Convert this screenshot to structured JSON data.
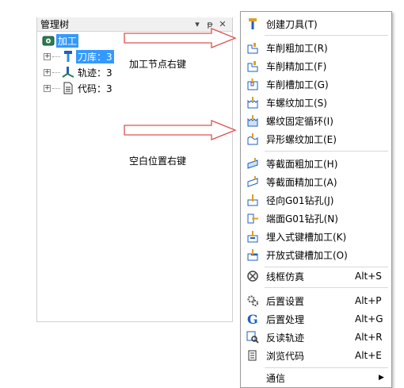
{
  "tree": {
    "title": "管理树",
    "header_buttons": {
      "dropdown": "▾",
      "pin": "ᵽ",
      "close": "✕"
    },
    "root": {
      "label": "加工",
      "icon": "machining-root-icon"
    },
    "children": [
      {
        "label": "刀库：3",
        "icon": "tool-library-icon",
        "selected": true
      },
      {
        "label": "轨迹：3",
        "icon": "toolpath-icon"
      },
      {
        "label": "代码：3",
        "icon": "code-file-icon"
      }
    ]
  },
  "annotations": {
    "node_right_click": "加工节点右键",
    "blank_right_click": "空白位置右键"
  },
  "menu": {
    "groups": [
      [
        {
          "label": "创建刀具(T)",
          "icon": "create-tool-icon"
        }
      ],
      [
        {
          "label": "车削粗加工(R)",
          "icon": "turn-rough-icon"
        },
        {
          "label": "车削精加工(F)",
          "icon": "turn-finish-icon"
        },
        {
          "label": "车削槽加工(G)",
          "icon": "turn-groove-icon"
        },
        {
          "label": "车螺纹加工(S)",
          "icon": "thread-turn-icon"
        },
        {
          "label": "螺纹固定循环(I)",
          "icon": "thread-cycle-icon"
        },
        {
          "label": "异形螺纹加工(E)",
          "icon": "special-thread-icon"
        }
      ],
      [
        {
          "label": "等截面粗加工(H)",
          "icon": "section-rough-icon"
        },
        {
          "label": "等截面精加工(A)",
          "icon": "section-finish-icon"
        },
        {
          "label": "径向G01钻孔(J)",
          "icon": "radial-drill-icon"
        },
        {
          "label": "端面G01钻孔(N)",
          "icon": "face-drill-icon"
        },
        {
          "label": "埋入式键槽加工(K)",
          "icon": "embedded-keyway-icon"
        },
        {
          "label": "开放式键槽加工(O)",
          "icon": "open-keyway-icon"
        }
      ],
      [
        {
          "label": "线框仿真",
          "icon": "wireframe-sim-icon",
          "shortcut": "Alt+S"
        }
      ],
      [
        {
          "label": "后置设置",
          "icon": "post-settings-icon",
          "shortcut": "Alt+P"
        },
        {
          "label": "后置处理",
          "icon": "post-process-icon",
          "shortcut": "Alt+G"
        },
        {
          "label": "反读轨迹",
          "icon": "reverse-read-icon",
          "shortcut": "Alt+R"
        },
        {
          "label": "浏览代码",
          "icon": "browse-code-icon",
          "shortcut": "Alt+E"
        }
      ],
      [
        {
          "label": "通信",
          "icon": "",
          "submenu": true
        }
      ]
    ],
    "submenu_arrow": "▶"
  },
  "colors": {
    "selection": "#3399ff",
    "arrow_fill": "#ffffff",
    "arrow_stroke": "#d9534f",
    "icon_blue": "#1f5fbf"
  }
}
